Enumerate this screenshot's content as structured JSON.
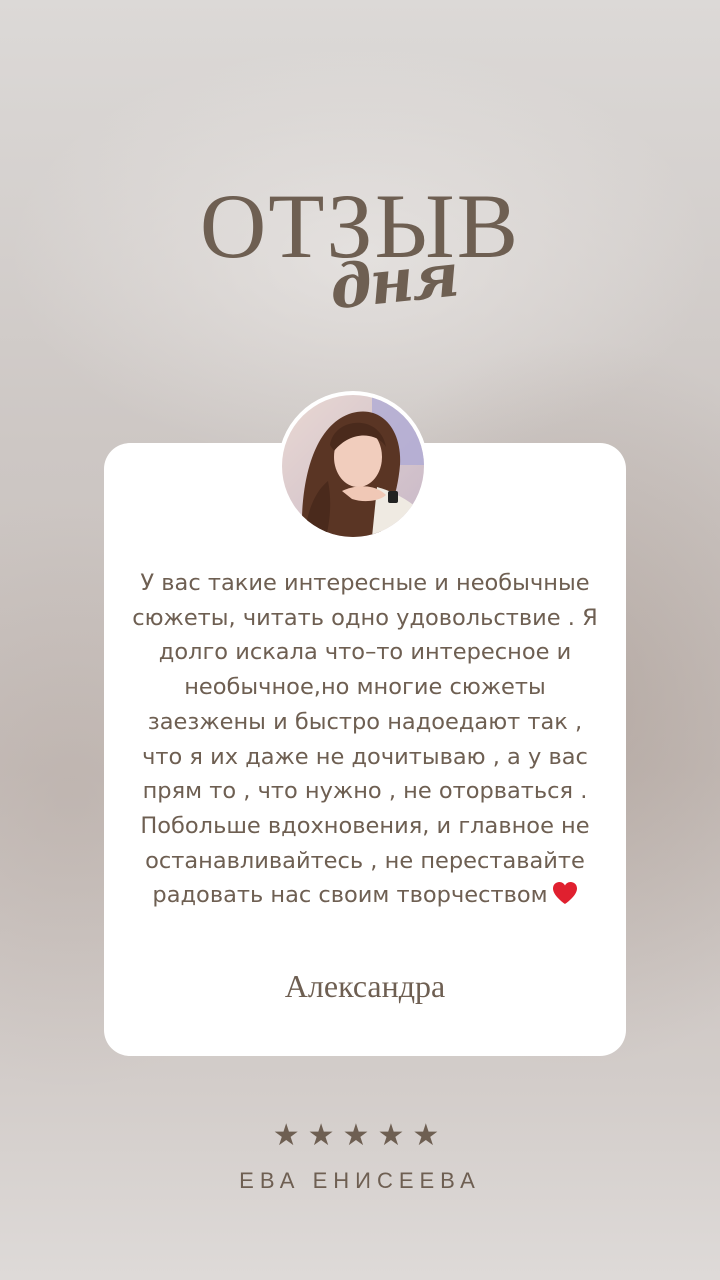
{
  "header": {
    "title": "ОТЗЫВ",
    "subtitle": "дня"
  },
  "review": {
    "lines": [
      "У вас такие интересные и необычные",
      "сюжеты, читать одно удовольствие . Я",
      "долго искала что–то интересное и",
      "необычное,но многие сюжеты",
      "заезжены и быстро надоедают так ,",
      "что я их даже не дочитываю , а у вас",
      "прям то , что нужно , не оторваться .",
      "Побольше вдохновения, и главное не",
      "останавливайтесь , не переставайте",
      "радовать нас своим творчеством"
    ],
    "emoji": "heart-icon",
    "author": "Александра"
  },
  "rating": {
    "stars": 5,
    "max": 5,
    "color": "#6e5f52"
  },
  "signature": "ЕВА ЕНИСЕЕВА",
  "colors": {
    "text": "#6e5f52",
    "heart": "#e0202f",
    "card": "#ffffff"
  }
}
